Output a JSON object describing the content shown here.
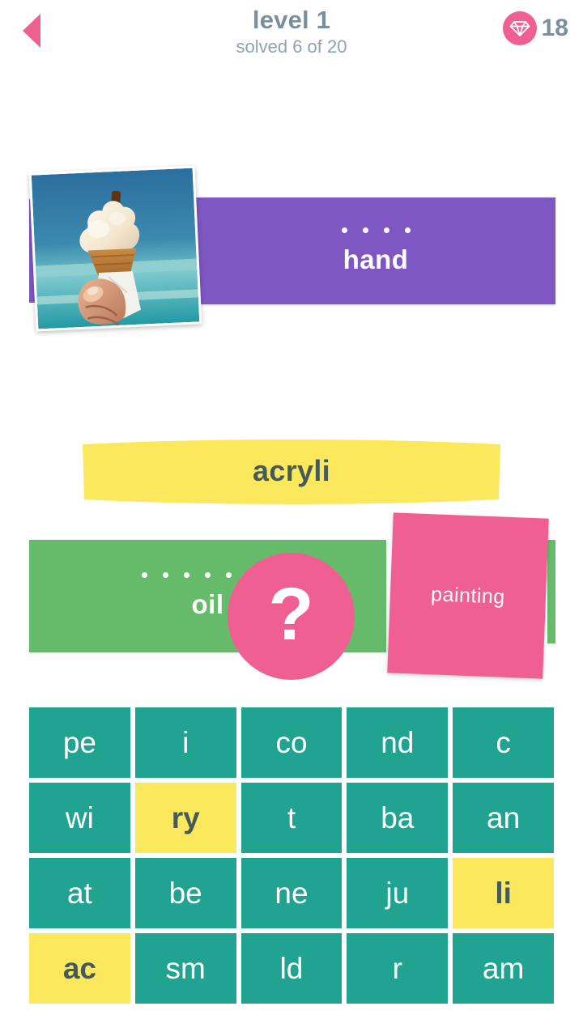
{
  "header": {
    "back_icon": "back-arrow-icon",
    "title": "level 1",
    "subtitle": "solved 6 of 20",
    "gem_icon": "gem-icon",
    "gem_count": "18",
    "title_color": "#78909c",
    "accent_pink": "#ef5f91"
  },
  "puzzles": [
    {
      "id": "hand",
      "type": "image-clue",
      "image_alt": "hand holding soft-serve ice cream cone at the beach",
      "card_color": "#7e57c2",
      "dots": 4,
      "word": "hand"
    },
    {
      "id": "oil",
      "type": "word-clue",
      "card_color": "#66bb6a",
      "dots": 7,
      "word": "oil",
      "overlay_card": {
        "word": "painting",
        "color": "#ef5f91"
      }
    },
    {
      "id": "acryli",
      "type": "answer-banner",
      "card_color": "#fce85c",
      "word": "acryli",
      "text_color": "#455a5a"
    }
  ],
  "hint_button": {
    "icon": "question-mark-icon",
    "label": "?",
    "color": "#ef5f91"
  },
  "tile_grid": {
    "columns": 5,
    "rows": 4,
    "tile_color": "#21a391",
    "selected_color": "#fce85c",
    "tiles": [
      {
        "label": "pe",
        "selected": false
      },
      {
        "label": "i",
        "selected": false
      },
      {
        "label": "co",
        "selected": false
      },
      {
        "label": "nd",
        "selected": false
      },
      {
        "label": "c",
        "selected": false
      },
      {
        "label": "wi",
        "selected": false
      },
      {
        "label": "ry",
        "selected": true
      },
      {
        "label": "t",
        "selected": false
      },
      {
        "label": "ba",
        "selected": false
      },
      {
        "label": "an",
        "selected": false
      },
      {
        "label": "at",
        "selected": false
      },
      {
        "label": "be",
        "selected": false
      },
      {
        "label": "ne",
        "selected": false
      },
      {
        "label": "ju",
        "selected": false
      },
      {
        "label": "li",
        "selected": true
      },
      {
        "label": "ac",
        "selected": true
      },
      {
        "label": "sm",
        "selected": false
      },
      {
        "label": "ld",
        "selected": false
      },
      {
        "label": "r",
        "selected": false
      },
      {
        "label": "am",
        "selected": false
      }
    ]
  }
}
